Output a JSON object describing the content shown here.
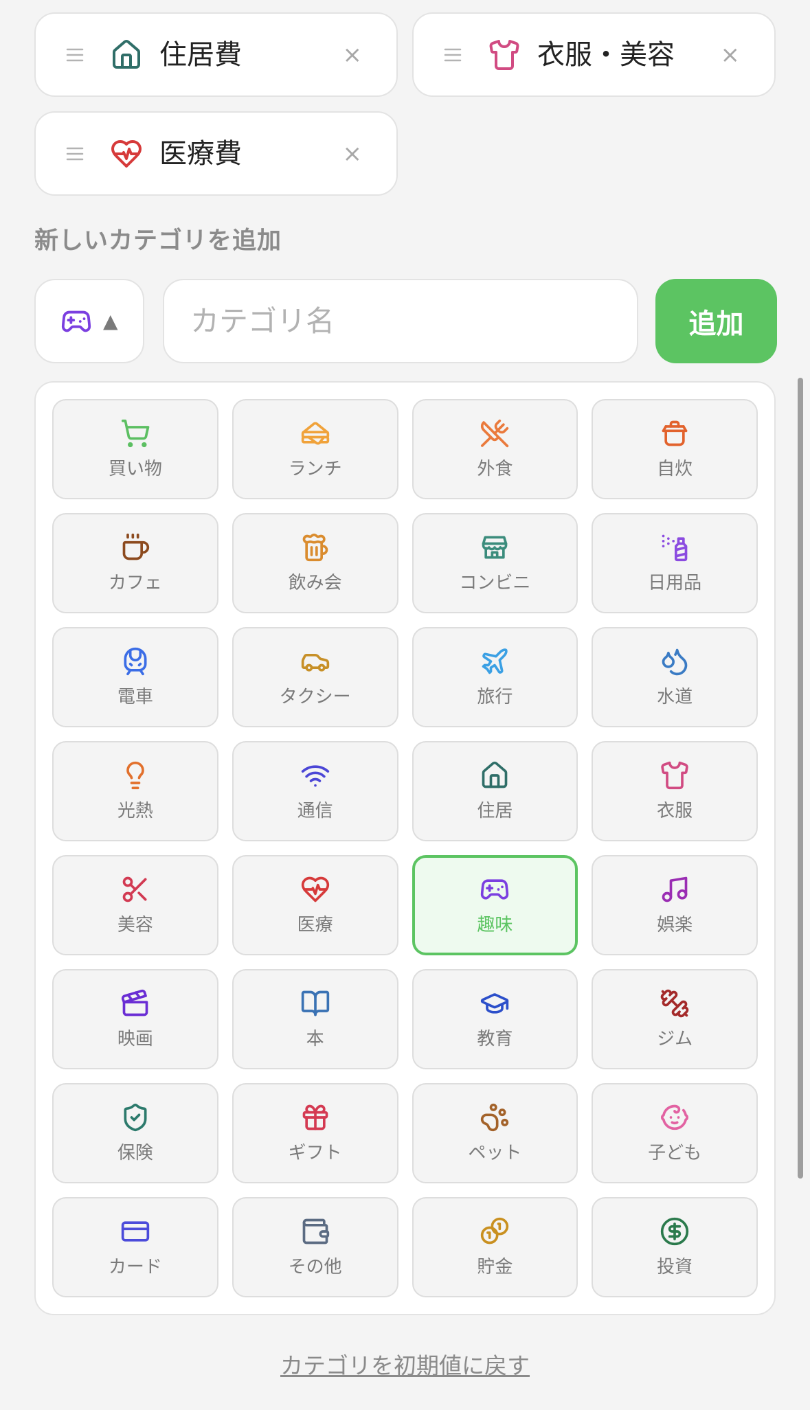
{
  "categories": [
    {
      "label": "住居費",
      "icon": "home-icon",
      "color": "#2f6e68"
    },
    {
      "label": "衣服・美容",
      "icon": "shirt-icon",
      "color": "#d14b82"
    },
    {
      "label": "医療費",
      "icon": "heart-pulse-icon",
      "color": "#d63a3a"
    }
  ],
  "drag_handle_icon": "grip-lines-icon",
  "remove_glyph": "×",
  "add_section": {
    "title": "新しいカテゴリを追加",
    "selected_icon": "gamepad-icon",
    "selected_icon_color": "#7b3fe0",
    "toggle_glyph": "▲",
    "input_placeholder": "カテゴリ名",
    "add_label": "追加"
  },
  "icon_picker": {
    "items": [
      {
        "label": "買い物",
        "icon": "shopping-cart-icon",
        "color": "#5cbf62"
      },
      {
        "label": "ランチ",
        "icon": "sandwich-icon",
        "color": "#f0a23a"
      },
      {
        "label": "外食",
        "icon": "utensils-crossed-icon",
        "color": "#ea7a3c"
      },
      {
        "label": "自炊",
        "icon": "cooking-pot-icon",
        "color": "#e2622c"
      },
      {
        "label": "カフェ",
        "icon": "coffee-icon",
        "color": "#8c4a1e"
      },
      {
        "label": "飲み会",
        "icon": "beer-icon",
        "color": "#da8c2e"
      },
      {
        "label": "コンビニ",
        "icon": "store-icon",
        "color": "#3b8c7c"
      },
      {
        "label": "日用品",
        "icon": "spray-can-icon",
        "color": "#8b4be0"
      },
      {
        "label": "電車",
        "icon": "train-icon",
        "color": "#3b6de6"
      },
      {
        "label": "タクシー",
        "icon": "car-icon",
        "color": "#c79028"
      },
      {
        "label": "旅行",
        "icon": "plane-icon",
        "color": "#3ba0e4"
      },
      {
        "label": "水道",
        "icon": "droplets-icon",
        "color": "#3a7bc4"
      },
      {
        "label": "光熱",
        "icon": "lightbulb-icon",
        "color": "#e2702c"
      },
      {
        "label": "通信",
        "icon": "wifi-icon",
        "color": "#4b46d6"
      },
      {
        "label": "住居",
        "icon": "home-icon",
        "color": "#2f6e68"
      },
      {
        "label": "衣服",
        "icon": "shirt-icon",
        "color": "#d14b82"
      },
      {
        "label": "美容",
        "icon": "scissors-icon",
        "color": "#d23a52"
      },
      {
        "label": "医療",
        "icon": "heart-pulse-icon",
        "color": "#d63a3a"
      },
      {
        "label": "趣味",
        "icon": "gamepad-icon",
        "color": "#7b3fe0",
        "selected": true
      },
      {
        "label": "娯楽",
        "icon": "music-icon",
        "color": "#9a2db3"
      },
      {
        "label": "映画",
        "icon": "clapperboard-icon",
        "color": "#6a2dd4"
      },
      {
        "label": "本",
        "icon": "book-open-icon",
        "color": "#3a72b4"
      },
      {
        "label": "教育",
        "icon": "graduation-cap-icon",
        "color": "#2c4fca"
      },
      {
        "label": "ジム",
        "icon": "dumbbell-icon",
        "color": "#a42a2a"
      },
      {
        "label": "保険",
        "icon": "shield-check-icon",
        "color": "#2c7a6c"
      },
      {
        "label": "ギフト",
        "icon": "gift-icon",
        "color": "#d43a52"
      },
      {
        "label": "ペット",
        "icon": "paw-print-icon",
        "color": "#a3622a"
      },
      {
        "label": "子ども",
        "icon": "baby-icon",
        "color": "#e262a2"
      },
      {
        "label": "カード",
        "icon": "credit-card-icon",
        "color": "#4b4bda"
      },
      {
        "label": "その他",
        "icon": "wallet-icon",
        "color": "#5b6b82"
      },
      {
        "label": "貯金",
        "icon": "coins-icon",
        "color": "#c99020"
      },
      {
        "label": "投資",
        "icon": "dollar-circle-icon",
        "color": "#2b7a4c"
      }
    ]
  },
  "reset_link": "カテゴリを初期値に戻す",
  "colors": {
    "accent": "#5cc462",
    "background": "#f4f4f4",
    "handle": "#b3b3b3"
  }
}
